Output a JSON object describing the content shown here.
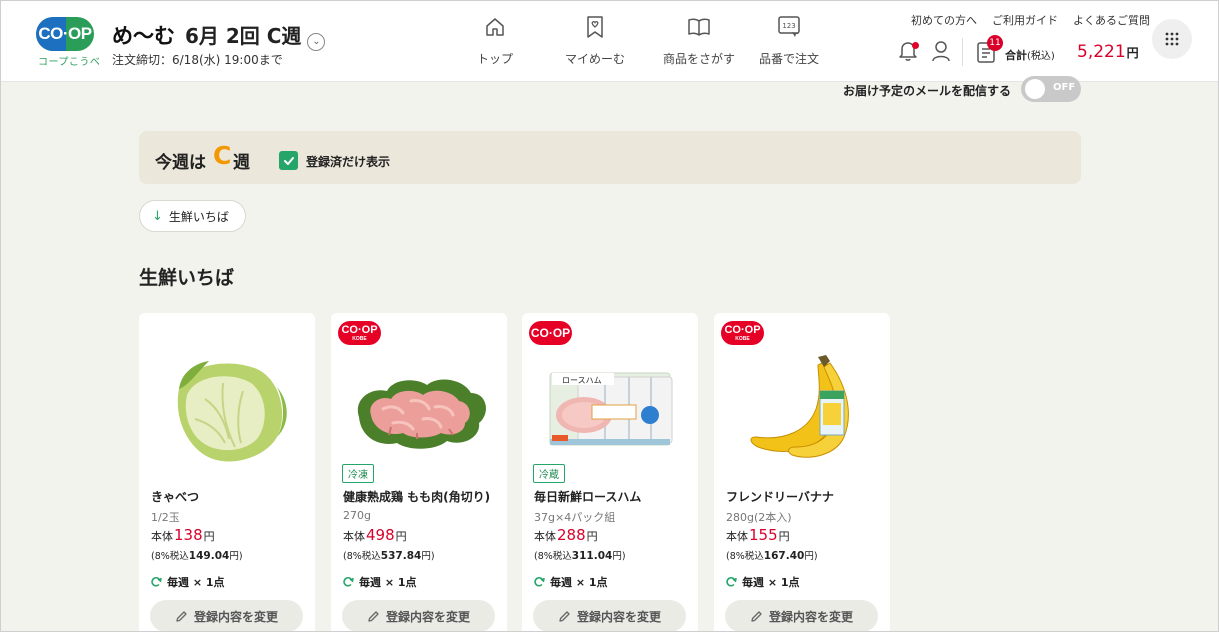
{
  "header": {
    "logo_text": "CO·OP",
    "logo_sub": "コープこうべ",
    "app_name": "め〜む",
    "week_label": "6月 2回 C週",
    "deadline": "注文締切：6/18(水) 19:00まで",
    "nav": [
      {
        "label": "トップ",
        "icon": "home-icon"
      },
      {
        "label": "マイめーむ",
        "icon": "heart-bookmark-icon"
      },
      {
        "label": "商品をさがす",
        "icon": "book-icon"
      },
      {
        "label": "品番で注文",
        "icon": "number-entry-icon"
      }
    ],
    "top_links": [
      "初めての方へ",
      "ご利用ガイド",
      "よくあるご質問"
    ],
    "cart_count": "11",
    "total_label": "合計",
    "total_tax_note": "(税込)",
    "total_value": "5,221",
    "total_unit": "円"
  },
  "notify": {
    "label": "お届け予定のメールを配信する",
    "toggle_state": "OFF"
  },
  "week_bar": {
    "prefix": "今週は",
    "week": "C",
    "suffix": "週",
    "filter_label": "登録済だけ表示",
    "filter_checked": true
  },
  "anchor_button": "生鮮いちば",
  "section_title": "生鮮いちば",
  "products": [
    {
      "brand_logo": "",
      "tag": "",
      "name": "きゃべつ",
      "size": "1/2玉",
      "price_prefix": "本体",
      "price": "138",
      "price_unit": "円",
      "tax_prefix": "(8%税込",
      "tax_value": "149.04",
      "tax_suffix": "円)",
      "frequency": "毎週 × 1点",
      "edit_label": "登録内容を変更"
    },
    {
      "brand_logo": "CO·OP KOBE",
      "tag": "冷凍",
      "name": "健康熟成鶏 もも肉(角切り)",
      "size": "270g",
      "price_prefix": "本体",
      "price": "498",
      "price_unit": "円",
      "tax_prefix": "(8%税込",
      "tax_value": "537.84",
      "tax_suffix": "円)",
      "frequency": "毎週 × 1点",
      "edit_label": "登録内容を変更"
    },
    {
      "brand_logo": "CO·OP",
      "tag": "冷蔵",
      "name": "毎日新鮮ロースハム",
      "size": "37g×4パック組",
      "price_prefix": "本体",
      "price": "288",
      "price_unit": "円",
      "tax_prefix": "(8%税込",
      "tax_value": "311.04",
      "tax_suffix": "円)",
      "frequency": "毎週 × 1点",
      "edit_label": "登録内容を変更",
      "package_label": "ロースハム"
    },
    {
      "brand_logo": "CO·OP KOBE",
      "tag": "",
      "name": "フレンドリーバナナ",
      "size": "280g(2本入)",
      "price_prefix": "本体",
      "price": "155",
      "price_unit": "円",
      "tax_prefix": "(8%税込",
      "tax_value": "167.40",
      "tax_suffix": "円)",
      "frequency": "毎週 × 1点",
      "edit_label": "登録内容を変更"
    }
  ],
  "colors": {
    "accent_green": "#26a56b",
    "price_red": "#d9002a",
    "week_orange": "#f39800",
    "background": "#f3f3ee"
  }
}
